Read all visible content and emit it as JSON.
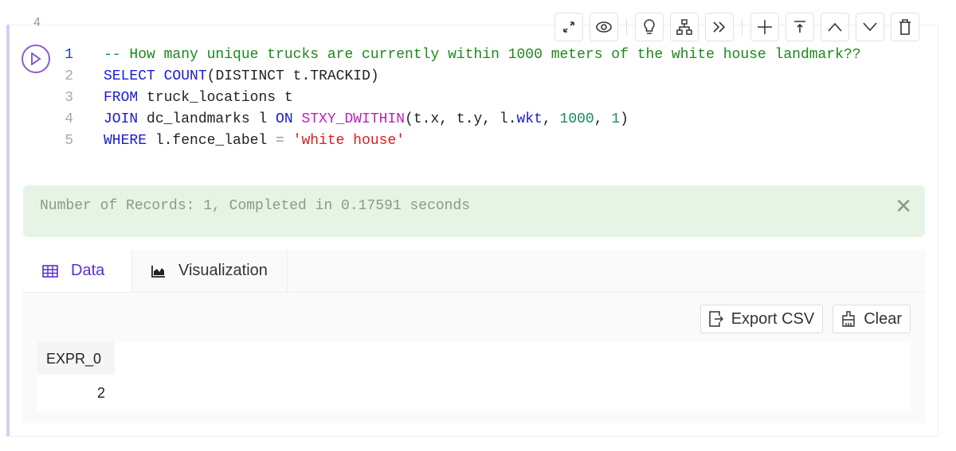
{
  "cell": {
    "number": "4"
  },
  "toolbar": {
    "icons": [
      "expand-icon",
      "eye-icon",
      "lightbulb-icon",
      "sitemap-icon",
      "double-chevron-right-icon",
      "plus-icon",
      "move-top-icon",
      "chevron-up-icon",
      "chevron-down-icon",
      "trash-icon"
    ]
  },
  "code": {
    "lines": [
      {
        "n": "1",
        "tokens": [
          {
            "t": "-- How many unique trucks are currently within 1000 meters of the white house landmark??",
            "c": "#1a8a1a"
          }
        ]
      },
      {
        "n": "2",
        "tokens": [
          {
            "t": "SELECT ",
            "c": "#1a1adb"
          },
          {
            "t": "COUNT",
            "c": "#1a1adb"
          },
          {
            "t": "(DISTINCT t.TRACKID)",
            "c": "#222"
          }
        ]
      },
      {
        "n": "3",
        "tokens": [
          {
            "t": "FROM ",
            "c": "#1a1adb"
          },
          {
            "t": "truck_locations t",
            "c": "#222"
          }
        ]
      },
      {
        "n": "4",
        "tokens": [
          {
            "t": "JOIN ",
            "c": "#1a1adb"
          },
          {
            "t": "dc_landmarks l ",
            "c": "#222"
          },
          {
            "t": "ON ",
            "c": "#1a1adb"
          },
          {
            "t": "STXY_DWITHIN",
            "c": "#c419c4"
          },
          {
            "t": "(t.x, t.y, l.",
            "c": "#222"
          },
          {
            "t": "wkt",
            "c": "#1a1adb"
          },
          {
            "t": ", ",
            "c": "#222"
          },
          {
            "t": "1000",
            "c": "#118a5a"
          },
          {
            "t": ", ",
            "c": "#222"
          },
          {
            "t": "1",
            "c": "#118a5a"
          },
          {
            "t": ")",
            "c": "#222"
          }
        ]
      },
      {
        "n": "5",
        "tokens": [
          {
            "t": "WHERE ",
            "c": "#1a1adb"
          },
          {
            "t": "l.fence_label ",
            "c": "#222"
          },
          {
            "t": "= ",
            "c": "#999"
          },
          {
            "t": "'white house'",
            "c": "#e01b1b"
          }
        ]
      }
    ]
  },
  "message": {
    "text": "Number of Records: 1, Completed in 0.17591 seconds"
  },
  "tabs": [
    {
      "label": "Data",
      "active": true
    },
    {
      "label": "Visualization",
      "active": false
    }
  ],
  "actions": {
    "export": "Export CSV",
    "clear": "Clear"
  },
  "table": {
    "columns": [
      "EXPR_0"
    ],
    "rows": [
      [
        "2"
      ]
    ]
  },
  "colors": {
    "accent": "#5b2fd0",
    "success_bg": "#e6f4e6"
  }
}
